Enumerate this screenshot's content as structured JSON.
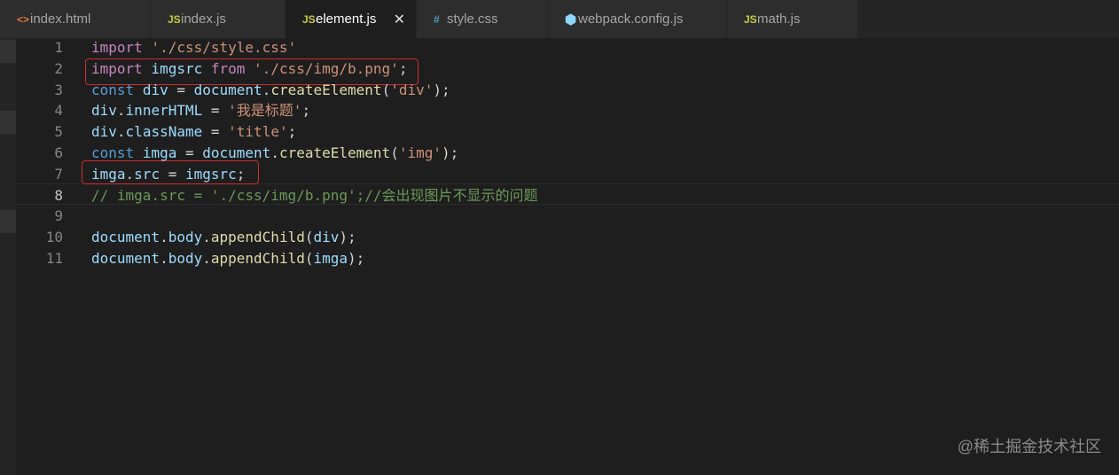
{
  "tabs": [
    {
      "label": "index.html",
      "icon": "html-file-icon",
      "glyph": "<>",
      "color": "#e37933"
    },
    {
      "label": "index.js",
      "icon": "js-file-icon",
      "glyph": "JS",
      "color": "#cbcb41"
    },
    {
      "label": "element.js",
      "icon": "js-file-icon",
      "glyph": "JS",
      "color": "#cbcb41",
      "active": true,
      "close": "✕"
    },
    {
      "label": "style.css",
      "icon": "css-file-icon",
      "glyph": "#",
      "color": "#519aba"
    },
    {
      "label": "webpack.config.js",
      "icon": "webpack-icon",
      "glyph": "⬢",
      "color": "#8ed6fb"
    },
    {
      "label": "math.js",
      "icon": "js-file-icon",
      "glyph": "JS",
      "color": "#cbcb41"
    }
  ],
  "lines": [
    {
      "n": "1",
      "tokens": [
        [
          "kw",
          "import"
        ],
        [
          "pl",
          " "
        ],
        [
          "str",
          "'./css/style.css'"
        ]
      ]
    },
    {
      "n": "2",
      "tokens": [
        [
          "kw",
          "import"
        ],
        [
          "pl",
          " "
        ],
        [
          "var",
          "imgsrc"
        ],
        [
          "pl",
          " "
        ],
        [
          "kw",
          "from"
        ],
        [
          "pl",
          " "
        ],
        [
          "str",
          "'./css/img/b.png'"
        ],
        [
          "pl",
          ";"
        ]
      ]
    },
    {
      "n": "3",
      "tokens": [
        [
          "kb",
          "const"
        ],
        [
          "pl",
          " "
        ],
        [
          "var",
          "div"
        ],
        [
          "pl",
          " = "
        ],
        [
          "var",
          "document"
        ],
        [
          "pl",
          "."
        ],
        [
          "fn",
          "createElement"
        ],
        [
          "pl",
          "("
        ],
        [
          "str",
          "'div'"
        ],
        [
          "pl",
          ");"
        ]
      ]
    },
    {
      "n": "4",
      "tokens": [
        [
          "var",
          "div"
        ],
        [
          "pl",
          "."
        ],
        [
          "var",
          "innerHTML"
        ],
        [
          "pl",
          " = "
        ],
        [
          "str",
          "'我是标题'"
        ],
        [
          "pl",
          ";"
        ]
      ]
    },
    {
      "n": "5",
      "tokens": [
        [
          "var",
          "div"
        ],
        [
          "pl",
          "."
        ],
        [
          "var",
          "className"
        ],
        [
          "pl",
          " = "
        ],
        [
          "str",
          "'title'"
        ],
        [
          "pl",
          ";"
        ]
      ]
    },
    {
      "n": "6",
      "tokens": [
        [
          "kb",
          "const"
        ],
        [
          "pl",
          " "
        ],
        [
          "var",
          "imga"
        ],
        [
          "pl",
          " = "
        ],
        [
          "var",
          "document"
        ],
        [
          "pl",
          "."
        ],
        [
          "fn",
          "createElement"
        ],
        [
          "pl",
          "("
        ],
        [
          "str",
          "'img'"
        ],
        [
          "pl",
          ");"
        ]
      ]
    },
    {
      "n": "7",
      "tokens": [
        [
          "var",
          "imga"
        ],
        [
          "pl",
          "."
        ],
        [
          "var",
          "src"
        ],
        [
          "pl",
          " = "
        ],
        [
          "var",
          "imgsrc"
        ],
        [
          "pl",
          ";"
        ]
      ]
    },
    {
      "n": "8",
      "tokens": [
        [
          "cm",
          "// imga.src = './css/img/b.png';//会出现图片不显示的问题"
        ]
      ],
      "active": true
    },
    {
      "n": "9",
      "tokens": []
    },
    {
      "n": "10",
      "tokens": [
        [
          "var",
          "document"
        ],
        [
          "pl",
          "."
        ],
        [
          "var",
          "body"
        ],
        [
          "pl",
          "."
        ],
        [
          "fn",
          "appendChild"
        ],
        [
          "pl",
          "("
        ],
        [
          "var",
          "div"
        ],
        [
          "pl",
          ");"
        ]
      ]
    },
    {
      "n": "11",
      "tokens": [
        [
          "var",
          "document"
        ],
        [
          "pl",
          "."
        ],
        [
          "var",
          "body"
        ],
        [
          "pl",
          "."
        ],
        [
          "fn",
          "appendChild"
        ],
        [
          "pl",
          "("
        ],
        [
          "var",
          "imga"
        ],
        [
          "pl",
          ");"
        ]
      ]
    }
  ],
  "colors": {
    "highlight_box": "#d02c2c",
    "keyword": "#c586c0",
    "storage": "#569cd6",
    "variable": "#9cdcfe",
    "function": "#dcdcaa",
    "string": "#ce9178",
    "comment": "#6a9955"
  },
  "watermark": "@稀土掘金技术社区"
}
